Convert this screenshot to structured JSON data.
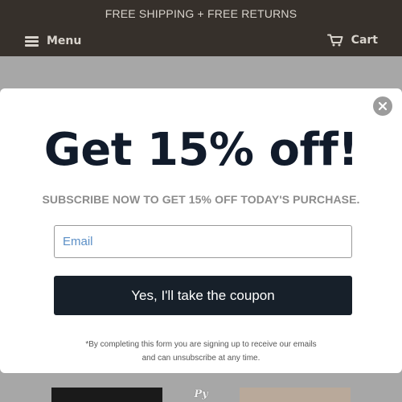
{
  "announcement": {
    "text": "FREE SHIPPING + FREE RETURNS"
  },
  "header": {
    "menu_label": "Menu",
    "menu_icon": "hamburger-icon",
    "cart_label": "Cart",
    "cart_icon": "cart-icon"
  },
  "popup": {
    "close_icon": "close-icon",
    "headline": "Get 15% off!",
    "subhead": "SUBSCRIBE NOW TO GET 15% OFF TODAY'S PURCHASE.",
    "email_placeholder": "Email",
    "email_value": "",
    "button_label": "Yes, I'll take the coupon",
    "disclaimer_line1": "*By completing this form you are signing up to receive our emails",
    "disclaimer_line2": "and can unsubscribe at any time."
  },
  "colors": {
    "header_bg": "#36302b",
    "overlay_bg": "#a7a7a7",
    "headline": "#111b2b",
    "button_bg": "#17202a",
    "placeholder": "#5b8fc6"
  }
}
